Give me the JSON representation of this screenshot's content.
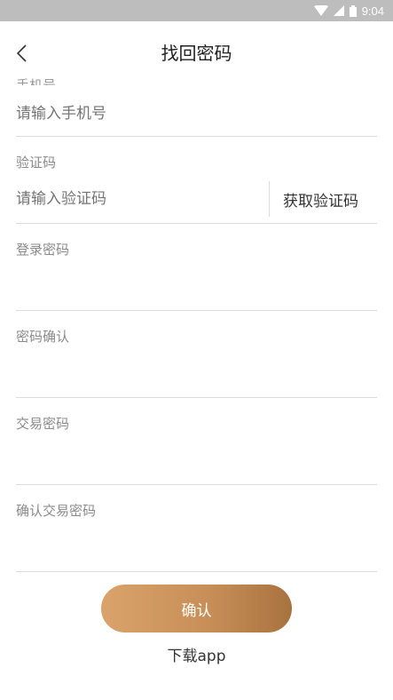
{
  "status_bar": {
    "time": "9:04"
  },
  "nav": {
    "title": "找回密码"
  },
  "form": {
    "phone": {
      "label_peek": "手机号",
      "placeholder": "请输入手机号"
    },
    "code": {
      "label": "验证码",
      "placeholder": "请输入验证码",
      "get_code_label": "获取验证码"
    },
    "login_password": {
      "label": "登录密码",
      "placeholder": ""
    },
    "confirm_password": {
      "label": "密码确认",
      "placeholder": ""
    },
    "trade_password": {
      "label": "交易密码",
      "placeholder": ""
    },
    "confirm_trade_password": {
      "label": "确认交易密码",
      "placeholder": ""
    }
  },
  "actions": {
    "confirm_label": "确认",
    "download_label": "下载app"
  },
  "colors": {
    "accent_start": "#d9a36b",
    "accent_end": "#a8723f",
    "status_bar": "#bdbdbd"
  }
}
